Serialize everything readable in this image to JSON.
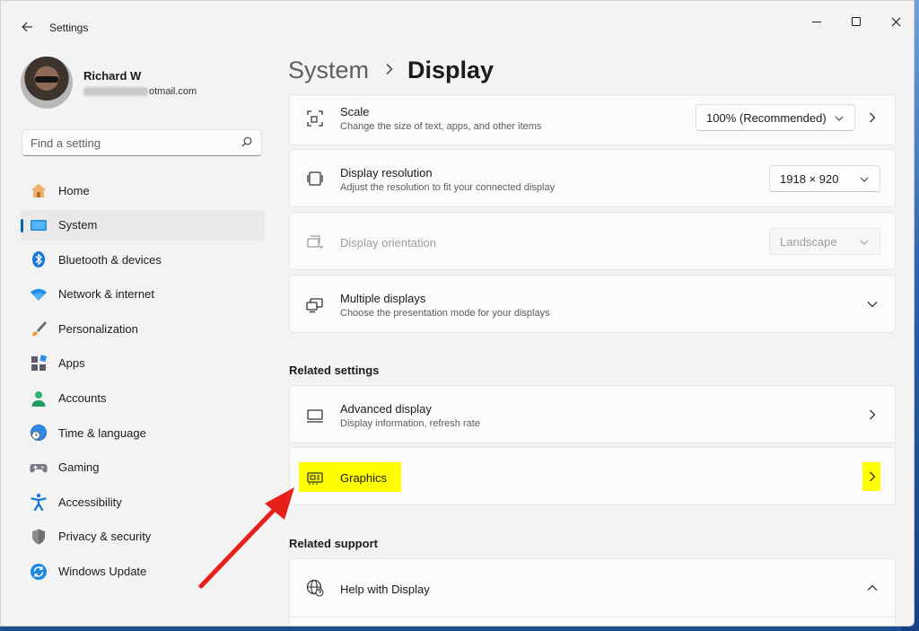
{
  "window": {
    "app_title": "Settings"
  },
  "profile": {
    "name": "Richard W",
    "email_suffix": "otmail.com"
  },
  "search": {
    "placeholder": "Find a setting"
  },
  "sidebar": {
    "items": [
      {
        "label": "Home",
        "icon": "home-icon"
      },
      {
        "label": "System",
        "icon": "system-icon",
        "active": true
      },
      {
        "label": "Bluetooth & devices",
        "icon": "bluetooth-icon"
      },
      {
        "label": "Network & internet",
        "icon": "wifi-icon"
      },
      {
        "label": "Personalization",
        "icon": "brush-icon"
      },
      {
        "label": "Apps",
        "icon": "apps-icon"
      },
      {
        "label": "Accounts",
        "icon": "person-icon"
      },
      {
        "label": "Time & language",
        "icon": "globe-clock-icon"
      },
      {
        "label": "Gaming",
        "icon": "gamepad-icon"
      },
      {
        "label": "Accessibility",
        "icon": "accessibility-icon"
      },
      {
        "label": "Privacy & security",
        "icon": "shield-icon"
      },
      {
        "label": "Windows Update",
        "icon": "update-icon"
      }
    ]
  },
  "header": {
    "parent": "System",
    "current": "Display"
  },
  "settings": {
    "scale": {
      "title": "Scale",
      "desc": "Change the size of text, apps, and other items",
      "value": "100% (Recommended)"
    },
    "resolution": {
      "title": "Display resolution",
      "desc": "Adjust the resolution to fit your connected display",
      "value": "1918 × 920"
    },
    "orientation": {
      "title": "Display orientation",
      "value": "Landscape"
    },
    "multiple": {
      "title": "Multiple displays",
      "desc": "Choose the presentation mode for your displays"
    }
  },
  "related_settings": {
    "heading": "Related settings",
    "advanced": {
      "title": "Advanced display",
      "desc": "Display information, refresh rate"
    },
    "graphics": {
      "title": "Graphics"
    }
  },
  "related_support": {
    "heading": "Related support",
    "help": {
      "title": "Help with Display"
    }
  },
  "colors": {
    "accent": "#0067c0",
    "highlight": "#ffff00",
    "arrow": "#e8201b"
  }
}
